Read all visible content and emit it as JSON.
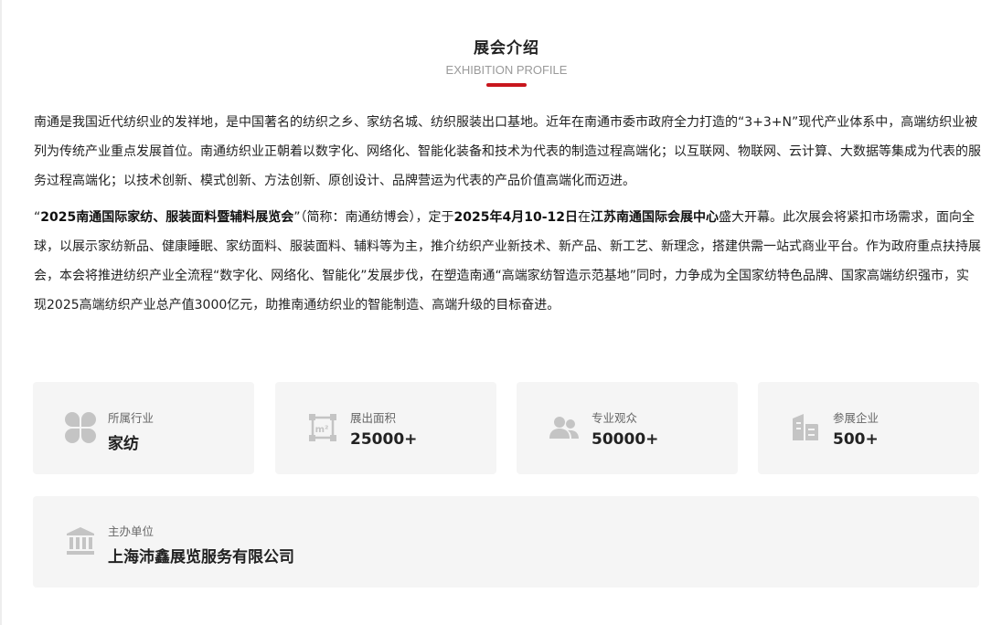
{
  "header": {
    "title": "展会介绍",
    "subtitle": "EXHIBITION PROFILE",
    "accent_color": "#c8161d"
  },
  "intro": {
    "paragraph1": "南通是我国近代纺织业的发祥地，是中国著名的纺织之乡、家纺名城、纺织服装出口基地。近年在南通市委市政府全力打造的“3+3+N”现代产业体系中，高端纺织业被列为传统产业重点发展首位。南通纺织业正朝着以数字化、网络化、智能化装备和技术为代表的制造过程高端化；以互联网、物联网、云计算、大数据等集成为代表的服务过程高端化；以技术创新、模式创新、方法创新、原创设计、品牌营运为代表的产品价值高端化而迈进。",
    "p2_open_quote": "“",
    "p2_name": "2025南通国际家纺、服装面料暨辅料展览会",
    "p2_text1": "”（简称：南通纺博会），定于",
    "p2_date": "2025年4月10-12日",
    "p2_text2": "在",
    "p2_venue": "江苏南通国际会展中心",
    "p2_text3": "盛大开幕。此次展会将紧扣市场需求，面向全球，以展示家纺新品、健康睡眠、家纺面料、服装面料、辅料等为主，推介纺织产业新技术、新产品、新工艺、新理念，搭建供需一站式商业平台。作为政府重点扶持展会，本会将推进纺织产业全流程“数字化、网络化、智能化”发展步伐，在塑造南通“高端家纺智造示范基地”同时，力争成为全国家纺特色品牌、国家高端纺织强市，实现2025高端纺织产业总产值3000亿元，助推南通纺织业的智能制造、高端升级的目标奋进。"
  },
  "stats": [
    {
      "label": "所属行业",
      "value": "家纺",
      "icon": "category-grid-icon"
    },
    {
      "label": "展出面积",
      "value": "25000+",
      "icon": "area-square-meter-icon"
    },
    {
      "label": "专业观众",
      "value": "50000+",
      "icon": "audience-people-icon"
    },
    {
      "label": "参展企业",
      "value": "500+",
      "icon": "building-enterprise-icon"
    }
  ],
  "organizer": {
    "label": "主办单位",
    "value": "上海沛鑫展览服务有限公司",
    "icon": "institution-building-icon"
  }
}
